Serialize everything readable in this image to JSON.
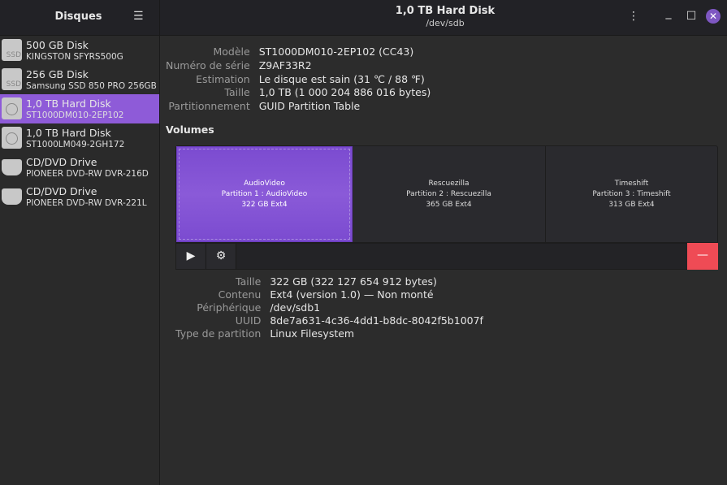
{
  "sidebar": {
    "title": "Disques",
    "items": [
      {
        "name": "500 GB Disk",
        "model": "KINGSTON SFYRS500G",
        "icon": "ssd-icon",
        "badge": "SSD"
      },
      {
        "name": "256 GB Disk",
        "model": "Samsung SSD 850 PRO 256GB",
        "icon": "ssd-icon",
        "badge": "SSD"
      },
      {
        "name": "1,0 TB Hard Disk",
        "model": "ST1000DM010-2EP102",
        "icon": "hdd-icon",
        "selected": true
      },
      {
        "name": "1,0 TB Hard Disk",
        "model": "ST1000LM049-2GH172",
        "icon": "hdd-icon"
      },
      {
        "name": "CD/DVD Drive",
        "model": "PIONEER DVD-RW  DVR-216D",
        "icon": "optical-drive-icon"
      },
      {
        "name": "CD/DVD Drive",
        "model": "PIONEER DVD-RW  DVR-221L",
        "icon": "optical-drive-icon"
      }
    ]
  },
  "header": {
    "title": "1,0 TB Hard Disk",
    "subtitle": "/dev/sdb"
  },
  "disk": {
    "rows": [
      {
        "label": "Modèle",
        "value": "ST1000DM010-2EP102 (CC43)"
      },
      {
        "label": "Numéro de série",
        "value": "Z9AF33R2"
      },
      {
        "label": "Estimation",
        "value": "Le disque est sain (31 ℃ / 88 ℉)"
      },
      {
        "label": "Taille",
        "value": "1,0 TB (1 000 204 886 016 bytes)"
      },
      {
        "label": "Partitionnement",
        "value": "GUID Partition Table"
      }
    ]
  },
  "volumes": {
    "heading": "Volumes",
    "partitions": [
      {
        "name": "AudioVideo",
        "desc": "Partition 1 : AudioVideo",
        "size": "322 GB Ext4",
        "share": 322
      },
      {
        "name": "Rescuezilla",
        "desc": "Partition 2 : Rescuezilla",
        "size": "365 GB Ext4",
        "share": 365
      },
      {
        "name": "Timeshift",
        "desc": "Partition 3 : Timeshift",
        "size": "313 GB Ext4",
        "share": 313
      }
    ]
  },
  "partition": {
    "rows": [
      {
        "label": "Taille",
        "value": "322 GB (322 127 654 912 bytes)"
      },
      {
        "label": "Contenu",
        "value": "Ext4 (version 1.0) — Non monté"
      },
      {
        "label": "Périphérique",
        "value": "/dev/sdb1"
      },
      {
        "label": "UUID",
        "value": "8de7a631-4c36-4dd1-b8dc-8042f5b1007f"
      },
      {
        "label": "Type de partition",
        "value": "Linux Filesystem"
      }
    ]
  },
  "colors": {
    "accent": "#8e5bd8",
    "danger": "#ef4b55"
  }
}
